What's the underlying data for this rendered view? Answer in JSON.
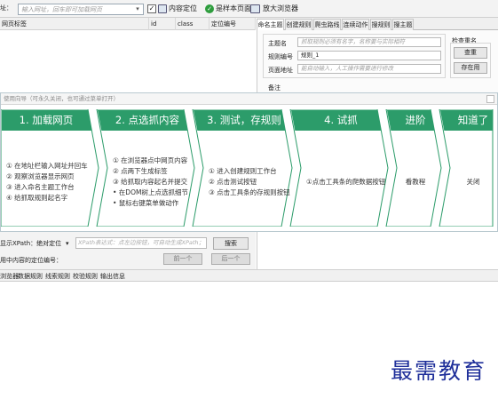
{
  "toolbar": {
    "url_placeholder": "输入网址，回车即可加载网页",
    "url_prefix": "址：",
    "dropdown_arrow": "▾",
    "content_locate": "内容定位",
    "is_sample_page": "是样本页面",
    "enlarge_browser": "放大浏览器",
    "content_locate_checked": true
  },
  "table": {
    "headers": [
      "网页标签",
      "id",
      "class",
      "定位编号"
    ]
  },
  "tabs": [
    "命名主题",
    "创建规则",
    "爬虫路线",
    "连续动作",
    "搜规则",
    "搜主题"
  ],
  "form": {
    "theme_name_label": "主题名",
    "theme_name_placeholder": "抓取规则必须有名字，名称要与实际相符",
    "rule_no_label": "规则编号",
    "rule_no_value": "规则_1",
    "page_addr_label": "页面地址",
    "page_addr_placeholder": "能自动输入，人工操作需要进行修改",
    "check_group_title": "检查重名",
    "check_button": "查重",
    "save_as_button": "存在用",
    "remark_label": "备注"
  },
  "wizard": {
    "bar_text": "使用向导（可永久关闭，也可通过菜单打开）",
    "accent": "#2c9c6a",
    "steps": [
      {
        "title": "1. 加载网页",
        "items": [
          "① 在地址栏输入网址并回车",
          "② 观察浏览器显示网页",
          "③ 进入命名主题工作台",
          "④ 给抓取规则起名字"
        ]
      },
      {
        "title": "2. 点选抓内容",
        "items": [
          "① 在浏览器点中网页内容",
          "② 点两下生成标签",
          "③ 给抓取内容起名并提交",
          "• 在DOM树上点选抓细节",
          "• 鼠标右键菜单做动作"
        ]
      },
      {
        "title": "3. 测试，存规则",
        "items": [
          "① 进入创建规则工作台",
          "② 点击测试按钮",
          "③ 点击工具条的存规则按钮"
        ]
      },
      {
        "title": "4. 试抓",
        "items": [
          "①点击工具条的爬数据按钮"
        ]
      },
      {
        "title": "进阶",
        "items": [
          "看教程"
        ]
      },
      {
        "title": "知道了",
        "items": [
          "关闭"
        ]
      }
    ]
  },
  "xpath": {
    "label": "显示XPath：绝对定位",
    "dropdown_arrow": "▾",
    "placeholder": "XPath表达式：点左边按钮，可自动生成XPath；",
    "search_button": "搜索",
    "locate_label": "用中内容的定位编号：",
    "prev_button": "前一个",
    "next_button": "后一个"
  },
  "bottom_tabs": [
    "浏览器",
    "数据规则",
    "线索规则",
    "校验规则",
    "输出信息"
  ],
  "watermark": "最需教育"
}
